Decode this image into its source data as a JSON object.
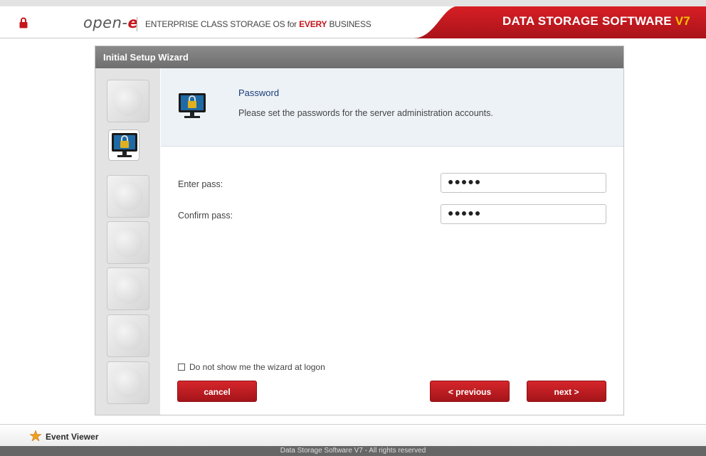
{
  "header": {
    "logo_text": "open-",
    "logo_accent": "e",
    "tagline_prefix": "ENTERPRISE CLASS STORAGE OS for ",
    "tagline_highlight": "EVERY",
    "tagline_suffix": " BUSINESS",
    "brand_text": "DATA STORAGE SOFTWARE ",
    "brand_version": "V7",
    "lock_icon": "lock-icon"
  },
  "wizard": {
    "title": "Initial Setup Wizard",
    "steps": [
      {
        "icon": "globe-icon",
        "active": false
      },
      {
        "icon": "password-monitor-icon",
        "active": true
      },
      {
        "icon": "network-globe-icon",
        "active": false
      },
      {
        "icon": "clock-globe-icon",
        "active": false
      },
      {
        "icon": "grid-globe-icon",
        "active": false
      },
      {
        "icon": "license-monitor-icon",
        "active": false
      },
      {
        "icon": "info-icon",
        "active": false
      }
    ],
    "section": {
      "title": "Password",
      "description": "Please set the passwords for the server administration accounts.",
      "icon": "monitor-lock-icon"
    },
    "fields": {
      "enter_pass": {
        "label": "Enter pass:",
        "value": "●●●●●"
      },
      "confirm_pass": {
        "label": "Confirm pass:",
        "value": "●●●●●"
      }
    },
    "checkbox_label": "Do not show me the wizard at logon",
    "checkbox_checked": false,
    "buttons": {
      "cancel": "cancel",
      "previous": "< previous",
      "next": "next >"
    }
  },
  "footer": {
    "event_viewer": "Event Viewer",
    "copyright": "Data Storage Software V7 - All rights reserved"
  },
  "colors": {
    "accent_red": "#c4161c",
    "title_bar_gray": "#7a7a7a",
    "version_yellow": "#f5c400"
  }
}
